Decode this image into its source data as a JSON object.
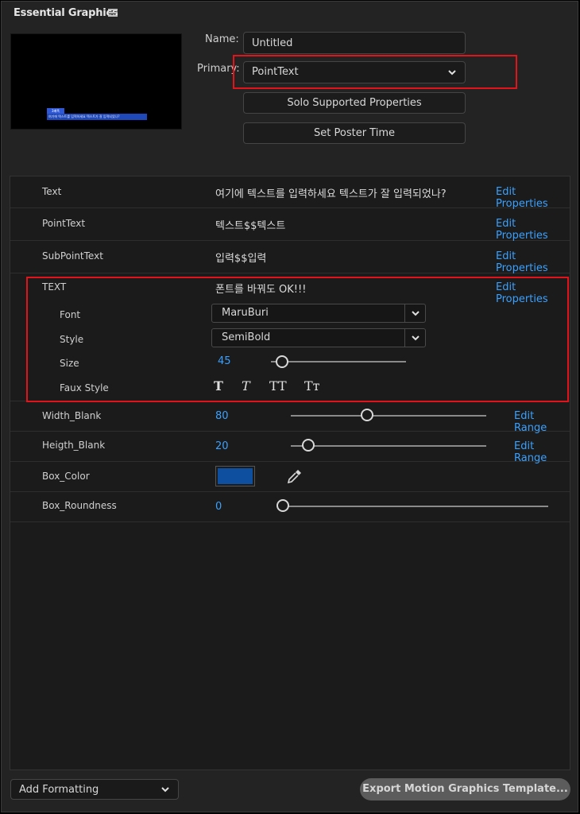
{
  "panel": {
    "title": "Essential Graphics",
    "menu_icon": "hamburger-icon"
  },
  "preview": {
    "tag_text": "3배폭",
    "caption_text": "여기에 텍스트를 입력하세요 텍스트가 잘 입력되었나?"
  },
  "name": {
    "label": "Name:",
    "value": "Untitled"
  },
  "primary": {
    "label": "Primary:",
    "value": "PointText"
  },
  "buttons": {
    "solo": "Solo Supported Properties",
    "poster": "Set Poster Time"
  },
  "properties": [
    {
      "label": "Text",
      "value": "여기에 텍스트를 입력하세요 텍스트가 잘 입력되었나?",
      "link": "Edit Properties"
    },
    {
      "label": "PointText",
      "value": "텍스트$$텍스트",
      "link": "Edit Properties"
    },
    {
      "label": "SubPointText",
      "value": "입력$$입력",
      "link": "Edit Properties"
    },
    {
      "label": "TEXT",
      "value": "폰트를 바꿔도 OK!!!",
      "link": "Edit Properties"
    }
  ],
  "text_group": {
    "font_label": "Font",
    "font_value": "MaruBuri",
    "style_label": "Style",
    "style_value": "SemiBold",
    "size_label": "Size",
    "size_value": "45",
    "size_fraction": 0.08,
    "faux_label": "Faux Style",
    "faux_options": [
      "T",
      "T",
      "TT",
      "Tт"
    ]
  },
  "ranges": [
    {
      "label": "Width_Blank",
      "value": "80",
      "fraction": 0.39,
      "link": "Edit Range"
    },
    {
      "label": "Heigth_Blank",
      "value": "20",
      "fraction": 0.09,
      "link": "Edit Range"
    }
  ],
  "box_color": {
    "label": "Box_Color",
    "color": "#0f4fa0",
    "tool_icon": "eyedropper-icon"
  },
  "box_roundness": {
    "label": "Box_Roundness",
    "value": "0",
    "fraction": 0.0
  },
  "footer": {
    "add_formatting": "Add Formatting",
    "export": "Export Motion Graphics Template..."
  },
  "colors": {
    "accent": "#3aa1ff",
    "highlight": "#e0141a",
    "panel_bg": "#232323"
  }
}
